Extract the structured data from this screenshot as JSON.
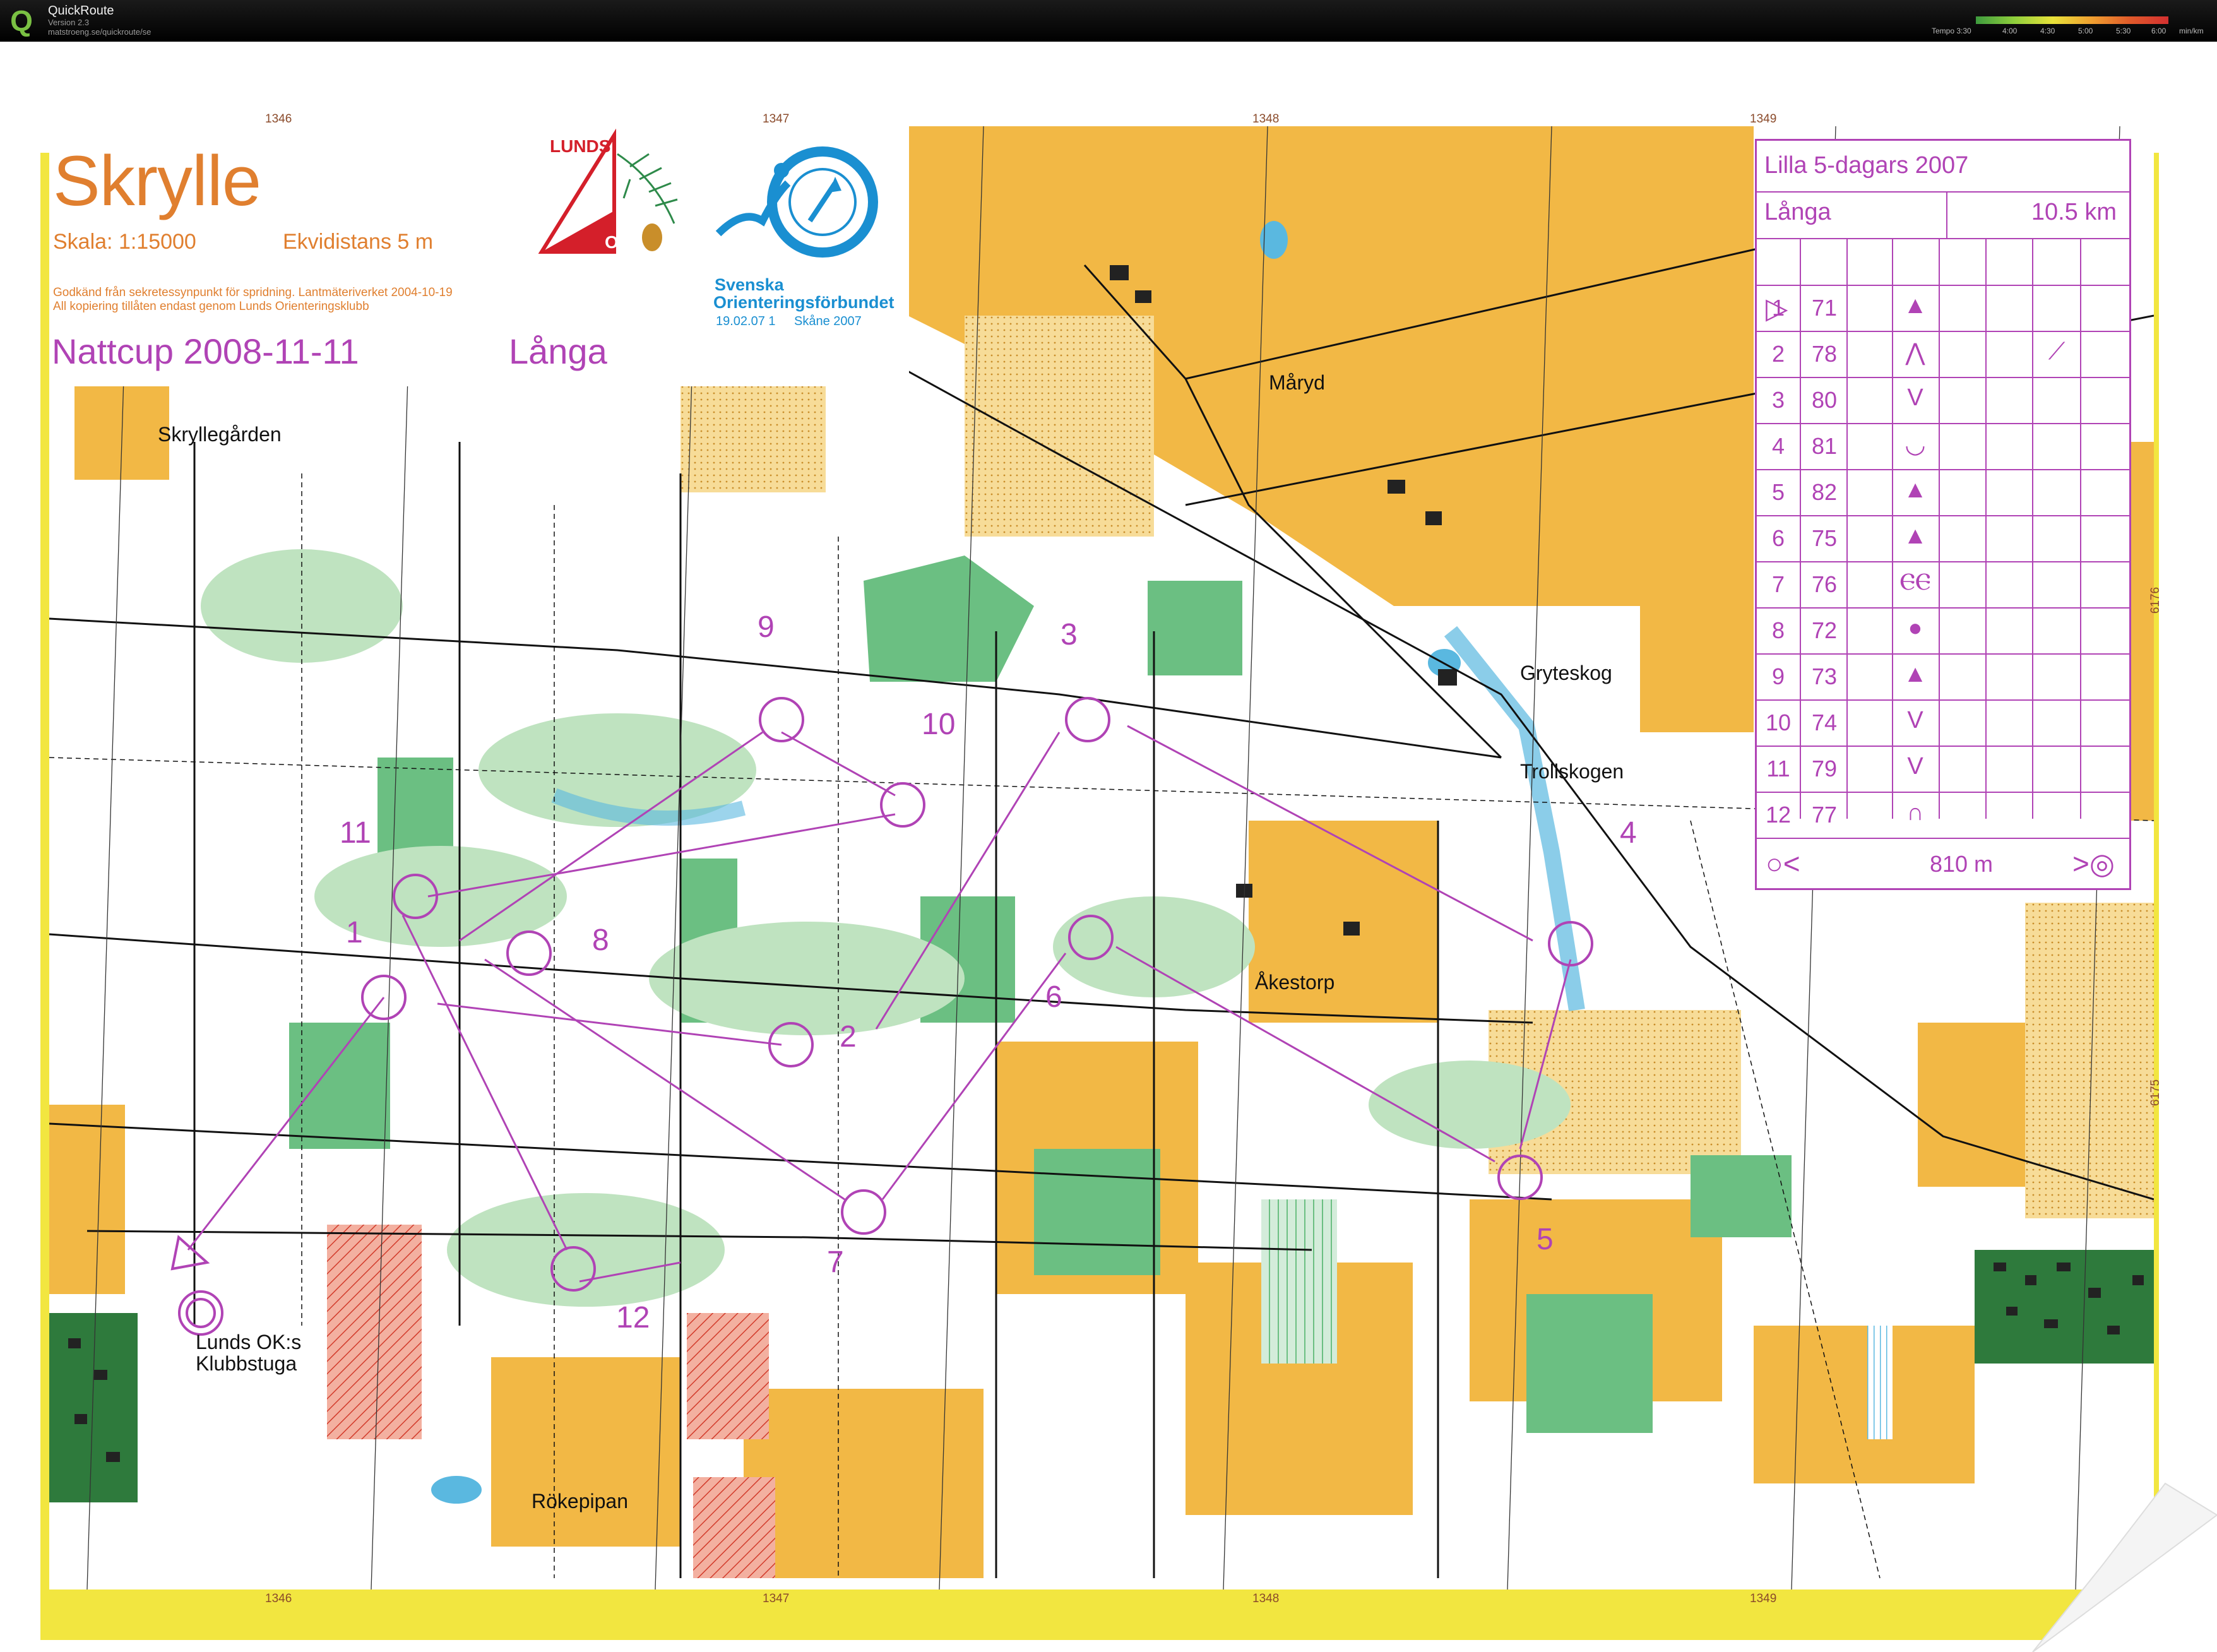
{
  "app": {
    "name": "QuickRoute",
    "version": "Version 2.3",
    "url": "matstroeng.se/quickroute/se"
  },
  "tempo_legend": {
    "label": "Tempo 3:30",
    "ticks": [
      "4:00",
      "4:30",
      "5:00",
      "5:30",
      "6:00"
    ],
    "unit": "min/km",
    "colors": [
      "#3e9b3e",
      "#8fcf3c",
      "#e8e23a",
      "#f0a030",
      "#e05a2a",
      "#d43030"
    ]
  },
  "map": {
    "title": "Skrylle",
    "scale": "Skala: 1:15000",
    "contour": "Ekvidistans 5 m",
    "approval_line1": "Godkänd från sekretessynpunkt för spridning. Lantmäteriverket 2004-10-19",
    "approval_line2": "All kopiering tillåten endast genom Lunds Orienteringsklubb",
    "event": "Nattcup 2008-11-11",
    "course": "Långa",
    "club_logo_text": "LUNDS",
    "club_logo_ok": "OK",
    "federation_line1": "Svenska",
    "federation_line2": "Orienteringsförbundet",
    "federation_date": "19.02.07 1",
    "federation_region": "Skåne 2007",
    "grid_top": [
      "1346",
      "1347",
      "1348",
      "1349"
    ],
    "grid_bottom": [
      "1346",
      "1347",
      "1348",
      "1349"
    ],
    "grid_right": [
      "6176",
      "6175"
    ],
    "places": {
      "skryllegarden": "Skryllegården",
      "maryd": "Måryd",
      "gryteskog": "Gryteskog",
      "trollskogen": "Trollskogen",
      "akestorp": "Åkestorp",
      "klubbstuga1": "Lunds OK:s",
      "klubbstuga2": "Klubbstuga",
      "rokepipan": "Rökepipan"
    },
    "colors": {
      "course": "#b043b5",
      "open_land": "#f2b845",
      "rough_open": "#f7dc98",
      "forest_green": "#6bbf82",
      "light_green": "#bfe3c0",
      "water": "#5ab8e0",
      "buildings": "#222222",
      "frame_yellow": "#f2e640"
    }
  },
  "controls": [
    {
      "num": "1"
    },
    {
      "num": "2"
    },
    {
      "num": "3"
    },
    {
      "num": "4"
    },
    {
      "num": "5"
    },
    {
      "num": "6"
    },
    {
      "num": "7"
    },
    {
      "num": "8"
    },
    {
      "num": "9"
    },
    {
      "num": "10"
    },
    {
      "num": "11"
    },
    {
      "num": "12"
    }
  ],
  "description": {
    "event": "Lilla 5-dagars 2007",
    "course": "Långa",
    "length": "10.5 km",
    "start_symbol": "▷",
    "rows": [
      {
        "num": "1",
        "code": "71",
        "sym": "▲",
        "dim": ""
      },
      {
        "num": "2",
        "code": "78",
        "sym": "⋀",
        "dim": "⟋"
      },
      {
        "num": "3",
        "code": "80",
        "sym": "V",
        "dim": ""
      },
      {
        "num": "4",
        "code": "81",
        "sym": "◡",
        "dim": ""
      },
      {
        "num": "5",
        "code": "82",
        "sym": "▲",
        "dim": ""
      },
      {
        "num": "6",
        "code": "75",
        "sym": "▲",
        "dim": ""
      },
      {
        "num": "7",
        "code": "76",
        "sym": "ⲈⲈ",
        "dim": ""
      },
      {
        "num": "8",
        "code": "72",
        "sym": "●",
        "dim": ""
      },
      {
        "num": "9",
        "code": "73",
        "sym": "▲",
        "dim": ""
      },
      {
        "num": "10",
        "code": "74",
        "sym": "V",
        "dim": ""
      },
      {
        "num": "11",
        "code": "79",
        "sym": "V",
        "dim": ""
      },
      {
        "num": "12",
        "code": "77",
        "sym": "∩",
        "dim": ""
      }
    ],
    "finish_distance": "810 m",
    "finish_left": "○<",
    "finish_right": ">◎"
  }
}
